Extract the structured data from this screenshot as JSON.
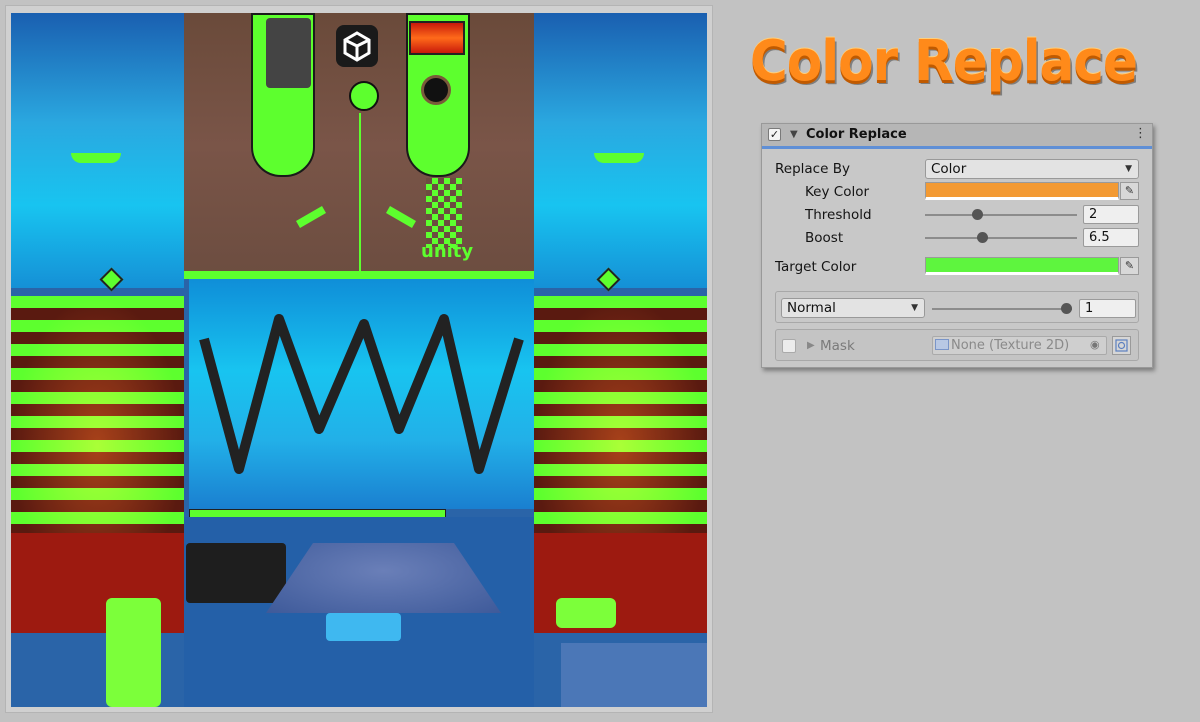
{
  "title": "Color Replace",
  "texture": {
    "logo_text": "unity"
  },
  "inspector": {
    "component_title": "Color Replace",
    "enabled": true,
    "menu_glyph": "⋮",
    "replace_by": {
      "label": "Replace By",
      "value": "Color"
    },
    "key_color": {
      "label": "Key Color",
      "color": "#f39a33"
    },
    "threshold": {
      "label": "Threshold",
      "value": "2",
      "level": 0.4
    },
    "boost": {
      "label": "Boost",
      "value": "6.5",
      "level": 0.45
    },
    "target_color": {
      "label": "Target Color",
      "color": "#5ef53e"
    },
    "blend": {
      "mode": "Normal",
      "value": "1",
      "level": 1.0
    },
    "mask": {
      "label": "Mask",
      "field": "None (Texture 2D)",
      "enabled": false
    }
  },
  "icons": {
    "checkbox": "check-icon",
    "foldout": "triangle-down-icon",
    "menu": "kebab-icon",
    "picker": "eyedropper-icon",
    "target": "target-icon",
    "texture": "texture-icon"
  }
}
